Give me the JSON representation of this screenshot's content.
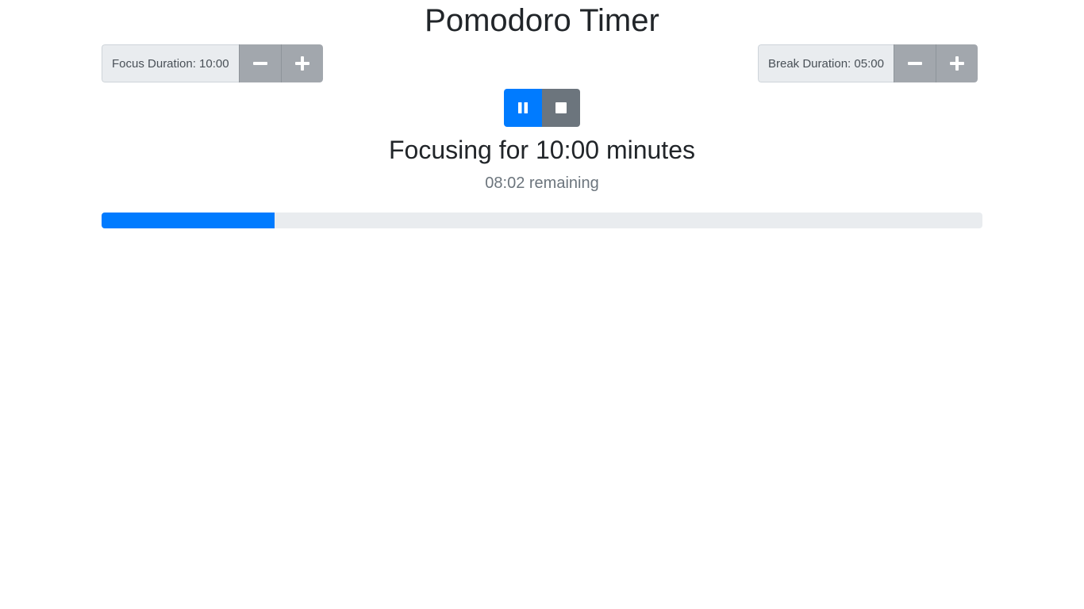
{
  "app": {
    "title": "Pomodoro Timer"
  },
  "focus": {
    "label": "Focus Duration: 10:00",
    "decrement_icon": "minus-icon",
    "increment_icon": "plus-icon"
  },
  "break": {
    "label": "Break Duration: 05:00",
    "decrement_icon": "minus-icon",
    "increment_icon": "plus-icon"
  },
  "controls": {
    "pause_icon": "pause-icon",
    "stop_icon": "stop-icon"
  },
  "status": {
    "heading": "Focusing for 10:00 minutes",
    "remaining": "08:02 remaining"
  },
  "progress": {
    "percent": 19.67
  },
  "colors": {
    "primary": "#007bff",
    "secondary": "#6c757d",
    "stepper": "#a2a7ad",
    "track": "#e9ecef"
  }
}
